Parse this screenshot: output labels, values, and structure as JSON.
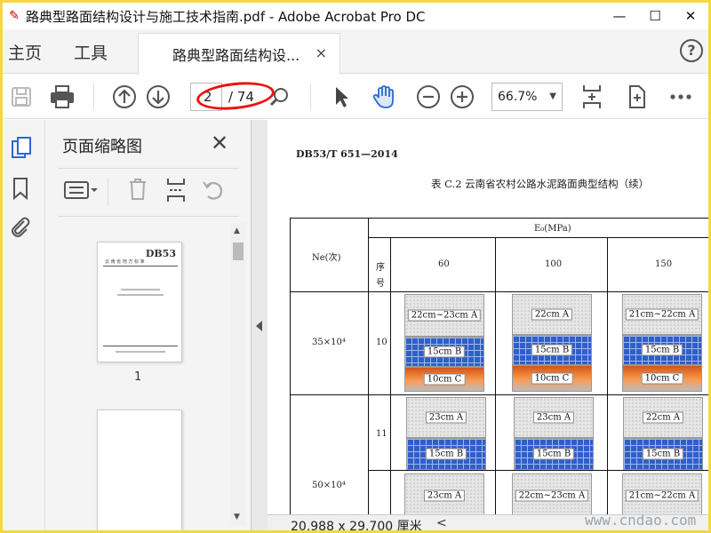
{
  "window": {
    "title": "路典型路面结构设计与施工技术指南.pdf - Adobe Acrobat Pro DC",
    "minimize": "—",
    "maximize": "☐",
    "close": "✕"
  },
  "nav": {
    "home": "主页",
    "tools": "工具"
  },
  "tab": {
    "label": "路典型路面结构设...",
    "close": "×",
    "help": "?"
  },
  "toolbar": {
    "page_value": "2",
    "page_total": "/ 74",
    "zoom": "66.7%"
  },
  "sidebar": {
    "title": "页面缩略图",
    "close": "✕",
    "thumb1_label": "1",
    "thumb1_logo": "DB53",
    "thumb1_header": "云 南 省 地 方 标 准"
  },
  "status": {
    "page_size": "20.988 x 29.700 厘米",
    "left_arrow": "<"
  },
  "watermark": "www.cndao.com",
  "doc": {
    "header": "DB53/T  651—2014",
    "caption": "表 C.2   云南省农村公路水泥路面典型结构（续）",
    "col_ne": "Ne(次)",
    "col_e0": "E₀(MPa)",
    "col_seq": [
      "序",
      "号"
    ],
    "col_vals": [
      "60",
      "100",
      "150"
    ],
    "rows": [
      {
        "ne": "35×10⁴",
        "seq": "10",
        "cells": [
          [
            "22cm~23cm A",
            "15cm B",
            "10cm C"
          ],
          [
            "22cm A",
            "15cm B",
            "10cm C"
          ],
          [
            "21cm~22cm A",
            "15cm B",
            "10cm C"
          ]
        ]
      },
      {
        "ne": "",
        "seq": "11",
        "cells": [
          [
            "23cm A",
            "15cm B"
          ],
          [
            "23cm A",
            "15cm B"
          ],
          [
            "22cm A",
            "15cm B"
          ]
        ]
      },
      {
        "ne": "50×10⁴",
        "seq": "",
        "cells": [
          [
            "23cm A"
          ],
          [
            "22cm~23cm A"
          ],
          [
            "21cm~22cm A"
          ]
        ]
      }
    ]
  }
}
